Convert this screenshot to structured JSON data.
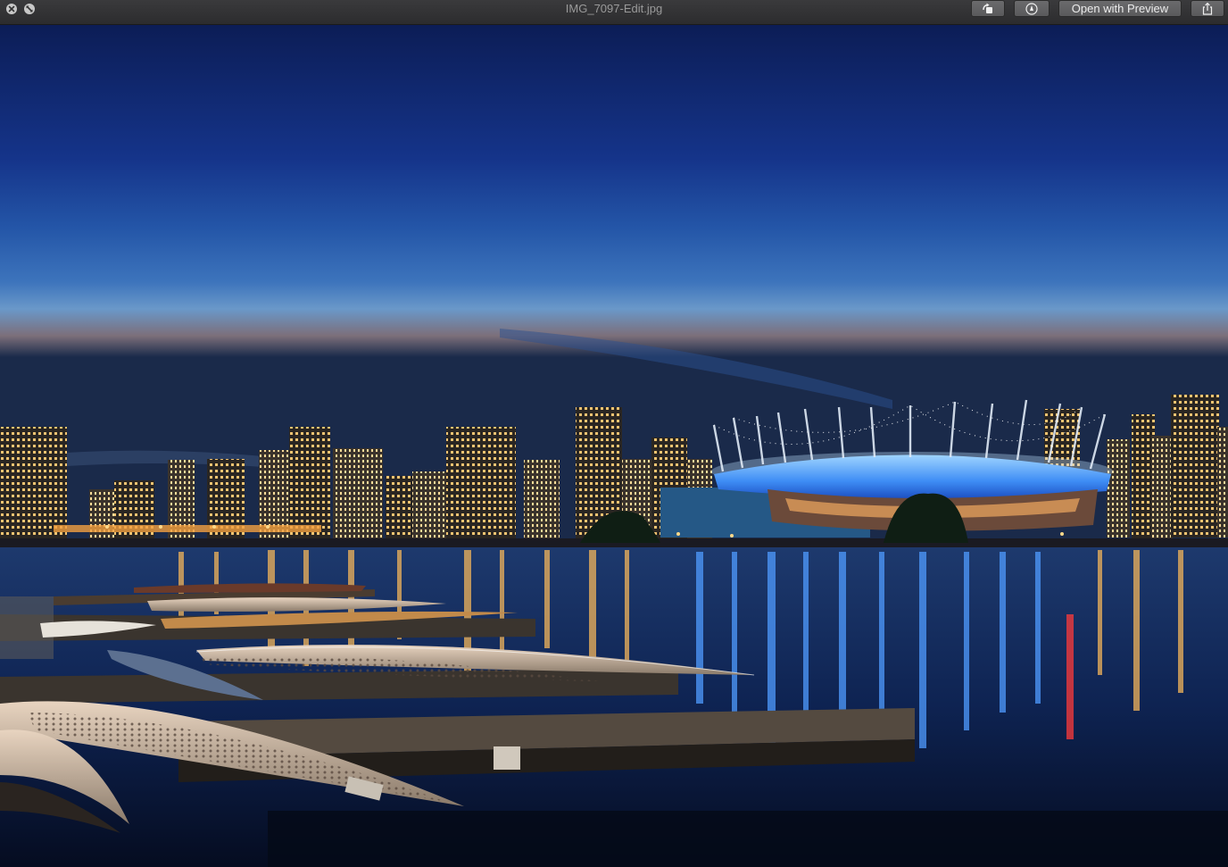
{
  "window": {
    "title": "IMG_7097-Edit.jpg",
    "toolbar": {
      "rotate_icon": "rotate-left-icon",
      "markup_icon": "markup-pen-icon",
      "open_with_label": "Open with Preview",
      "share_icon": "share-icon"
    },
    "controls": [
      "close-icon",
      "fullscreen-exit-icon"
    ]
  },
  "colors": {
    "titlebar": "#2c2c2e",
    "sky_top": "#0d1f5c",
    "sky_horizon": "#4f86c6",
    "water": "#0a1a3a",
    "stadium_glow": "#3b8cff"
  }
}
